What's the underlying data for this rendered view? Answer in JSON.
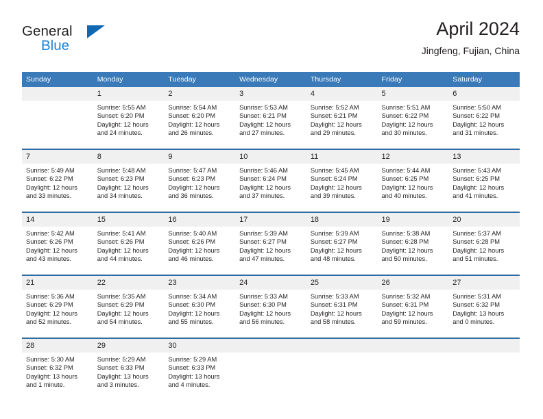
{
  "brand": {
    "name_top": "General",
    "name_bottom": "Blue",
    "accent_color": "#1068b3",
    "blue_text_color": "#1f83d6"
  },
  "header": {
    "title": "April 2024",
    "subtitle": "Jingfeng, Fujian, China"
  },
  "theme": {
    "header_row_bg": "#3a7ab8",
    "week_separator": "#2e6da4",
    "daynum_bg": "#f0f0f0",
    "text": "#231f20"
  },
  "calendar": {
    "day_headers": [
      "Sunday",
      "Monday",
      "Tuesday",
      "Wednesday",
      "Thursday",
      "Friday",
      "Saturday"
    ],
    "weeks": [
      {
        "days": [
          {
            "num": "",
            "sunrise": "",
            "sunset": "",
            "daylight1": "",
            "daylight2": ""
          },
          {
            "num": "1",
            "sunrise": "Sunrise: 5:55 AM",
            "sunset": "Sunset: 6:20 PM",
            "daylight1": "Daylight: 12 hours",
            "daylight2": "and 24 minutes."
          },
          {
            "num": "2",
            "sunrise": "Sunrise: 5:54 AM",
            "sunset": "Sunset: 6:20 PM",
            "daylight1": "Daylight: 12 hours",
            "daylight2": "and 26 minutes."
          },
          {
            "num": "3",
            "sunrise": "Sunrise: 5:53 AM",
            "sunset": "Sunset: 6:21 PM",
            "daylight1": "Daylight: 12 hours",
            "daylight2": "and 27 minutes."
          },
          {
            "num": "4",
            "sunrise": "Sunrise: 5:52 AM",
            "sunset": "Sunset: 6:21 PM",
            "daylight1": "Daylight: 12 hours",
            "daylight2": "and 29 minutes."
          },
          {
            "num": "5",
            "sunrise": "Sunrise: 5:51 AM",
            "sunset": "Sunset: 6:22 PM",
            "daylight1": "Daylight: 12 hours",
            "daylight2": "and 30 minutes."
          },
          {
            "num": "6",
            "sunrise": "Sunrise: 5:50 AM",
            "sunset": "Sunset: 6:22 PM",
            "daylight1": "Daylight: 12 hours",
            "daylight2": "and 31 minutes."
          }
        ]
      },
      {
        "days": [
          {
            "num": "7",
            "sunrise": "Sunrise: 5:49 AM",
            "sunset": "Sunset: 6:22 PM",
            "daylight1": "Daylight: 12 hours",
            "daylight2": "and 33 minutes."
          },
          {
            "num": "8",
            "sunrise": "Sunrise: 5:48 AM",
            "sunset": "Sunset: 6:23 PM",
            "daylight1": "Daylight: 12 hours",
            "daylight2": "and 34 minutes."
          },
          {
            "num": "9",
            "sunrise": "Sunrise: 5:47 AM",
            "sunset": "Sunset: 6:23 PM",
            "daylight1": "Daylight: 12 hours",
            "daylight2": "and 36 minutes."
          },
          {
            "num": "10",
            "sunrise": "Sunrise: 5:46 AM",
            "sunset": "Sunset: 6:24 PM",
            "daylight1": "Daylight: 12 hours",
            "daylight2": "and 37 minutes."
          },
          {
            "num": "11",
            "sunrise": "Sunrise: 5:45 AM",
            "sunset": "Sunset: 6:24 PM",
            "daylight1": "Daylight: 12 hours",
            "daylight2": "and 39 minutes."
          },
          {
            "num": "12",
            "sunrise": "Sunrise: 5:44 AM",
            "sunset": "Sunset: 6:25 PM",
            "daylight1": "Daylight: 12 hours",
            "daylight2": "and 40 minutes."
          },
          {
            "num": "13",
            "sunrise": "Sunrise: 5:43 AM",
            "sunset": "Sunset: 6:25 PM",
            "daylight1": "Daylight: 12 hours",
            "daylight2": "and 41 minutes."
          }
        ]
      },
      {
        "days": [
          {
            "num": "14",
            "sunrise": "Sunrise: 5:42 AM",
            "sunset": "Sunset: 6:26 PM",
            "daylight1": "Daylight: 12 hours",
            "daylight2": "and 43 minutes."
          },
          {
            "num": "15",
            "sunrise": "Sunrise: 5:41 AM",
            "sunset": "Sunset: 6:26 PM",
            "daylight1": "Daylight: 12 hours",
            "daylight2": "and 44 minutes."
          },
          {
            "num": "16",
            "sunrise": "Sunrise: 5:40 AM",
            "sunset": "Sunset: 6:26 PM",
            "daylight1": "Daylight: 12 hours",
            "daylight2": "and 46 minutes."
          },
          {
            "num": "17",
            "sunrise": "Sunrise: 5:39 AM",
            "sunset": "Sunset: 6:27 PM",
            "daylight1": "Daylight: 12 hours",
            "daylight2": "and 47 minutes."
          },
          {
            "num": "18",
            "sunrise": "Sunrise: 5:39 AM",
            "sunset": "Sunset: 6:27 PM",
            "daylight1": "Daylight: 12 hours",
            "daylight2": "and 48 minutes."
          },
          {
            "num": "19",
            "sunrise": "Sunrise: 5:38 AM",
            "sunset": "Sunset: 6:28 PM",
            "daylight1": "Daylight: 12 hours",
            "daylight2": "and 50 minutes."
          },
          {
            "num": "20",
            "sunrise": "Sunrise: 5:37 AM",
            "sunset": "Sunset: 6:28 PM",
            "daylight1": "Daylight: 12 hours",
            "daylight2": "and 51 minutes."
          }
        ]
      },
      {
        "days": [
          {
            "num": "21",
            "sunrise": "Sunrise: 5:36 AM",
            "sunset": "Sunset: 6:29 PM",
            "daylight1": "Daylight: 12 hours",
            "daylight2": "and 52 minutes."
          },
          {
            "num": "22",
            "sunrise": "Sunrise: 5:35 AM",
            "sunset": "Sunset: 6:29 PM",
            "daylight1": "Daylight: 12 hours",
            "daylight2": "and 54 minutes."
          },
          {
            "num": "23",
            "sunrise": "Sunrise: 5:34 AM",
            "sunset": "Sunset: 6:30 PM",
            "daylight1": "Daylight: 12 hours",
            "daylight2": "and 55 minutes."
          },
          {
            "num": "24",
            "sunrise": "Sunrise: 5:33 AM",
            "sunset": "Sunset: 6:30 PM",
            "daylight1": "Daylight: 12 hours",
            "daylight2": "and 56 minutes."
          },
          {
            "num": "25",
            "sunrise": "Sunrise: 5:33 AM",
            "sunset": "Sunset: 6:31 PM",
            "daylight1": "Daylight: 12 hours",
            "daylight2": "and 58 minutes."
          },
          {
            "num": "26",
            "sunrise": "Sunrise: 5:32 AM",
            "sunset": "Sunset: 6:31 PM",
            "daylight1": "Daylight: 12 hours",
            "daylight2": "and 59 minutes."
          },
          {
            "num": "27",
            "sunrise": "Sunrise: 5:31 AM",
            "sunset": "Sunset: 6:32 PM",
            "daylight1": "Daylight: 13 hours",
            "daylight2": "and 0 minutes."
          }
        ]
      },
      {
        "days": [
          {
            "num": "28",
            "sunrise": "Sunrise: 5:30 AM",
            "sunset": "Sunset: 6:32 PM",
            "daylight1": "Daylight: 13 hours",
            "daylight2": "and 1 minute."
          },
          {
            "num": "29",
            "sunrise": "Sunrise: 5:29 AM",
            "sunset": "Sunset: 6:33 PM",
            "daylight1": "Daylight: 13 hours",
            "daylight2": "and 3 minutes."
          },
          {
            "num": "30",
            "sunrise": "Sunrise: 5:29 AM",
            "sunset": "Sunset: 6:33 PM",
            "daylight1": "Daylight: 13 hours",
            "daylight2": "and 4 minutes."
          },
          {
            "num": "",
            "sunrise": "",
            "sunset": "",
            "daylight1": "",
            "daylight2": ""
          },
          {
            "num": "",
            "sunrise": "",
            "sunset": "",
            "daylight1": "",
            "daylight2": ""
          },
          {
            "num": "",
            "sunrise": "",
            "sunset": "",
            "daylight1": "",
            "daylight2": ""
          },
          {
            "num": "",
            "sunrise": "",
            "sunset": "",
            "daylight1": "",
            "daylight2": ""
          }
        ]
      }
    ]
  }
}
